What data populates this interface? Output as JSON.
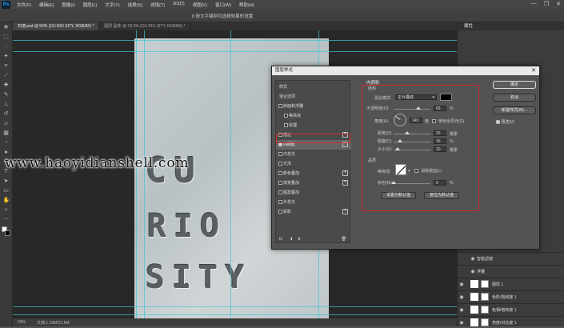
{
  "menubar": {
    "logo": "Ps",
    "items": [
      "文件(F)",
      "编辑(E)",
      "图像(I)",
      "图层(L)",
      "文字(Y)",
      "选择(S)",
      "滤镜(T)",
      "3D(D)",
      "视图(V)",
      "窗口(W)",
      "帮助(H)"
    ],
    "window_buttons": [
      "—",
      "❐",
      "✕"
    ]
  },
  "optionsbar": {
    "title": "8 段文字镂刻可选择效果的设置"
  },
  "tabs": [
    {
      "label": "石墙.psd @ 50% (CU RIO SITY, RGB/8#) *",
      "active": true
    },
    {
      "label": "图层 副本 @ 33.3% (CU RIO SITY, RGB/8#) *",
      "active": false
    }
  ],
  "document": {
    "line1": "CU",
    "line2": "RIO",
    "line3": "SITY"
  },
  "watermark": "www.haoyidianshell.com",
  "statusbar": {
    "zoom": "50%",
    "doc": "文档:1.19M/21.6M"
  },
  "right_panel": {
    "tab": "属性",
    "layers": [
      {
        "name": "智能滤镜",
        "sub": true
      },
      {
        "name": "浮雕",
        "sub": true
      },
      {
        "name": "图层 1"
      },
      {
        "name": "色阶/饱和度 1"
      },
      {
        "name": "色相/饱和度 1"
      },
      {
        "name": "亮度/对比度 1"
      }
    ]
  },
  "dialog": {
    "title": "图层样式",
    "close": "✕",
    "left_items": [
      {
        "label": "样式",
        "check": false,
        "plus": false
      },
      {
        "label": "混合选项",
        "check": false,
        "plus": false
      },
      {
        "label": "斜面和浮雕",
        "check": true,
        "checked": false,
        "plus": false
      },
      {
        "label": "等高线",
        "check": true,
        "checked": false,
        "plus": false,
        "indent": true
      },
      {
        "label": "纹理",
        "check": true,
        "checked": false,
        "plus": false,
        "indent": true
      },
      {
        "label": "描边",
        "check": true,
        "checked": false,
        "plus": true
      },
      {
        "label": "内阴影",
        "check": true,
        "checked": true,
        "plus": true,
        "selected": true
      },
      {
        "label": "内发光",
        "check": true,
        "checked": false,
        "plus": false
      },
      {
        "label": "光泽",
        "check": true,
        "checked": false,
        "plus": false
      },
      {
        "label": "颜色叠加",
        "check": true,
        "checked": false,
        "plus": true
      },
      {
        "label": "渐变叠加",
        "check": true,
        "checked": false,
        "plus": true
      },
      {
        "label": "图案叠加",
        "check": true,
        "checked": false,
        "plus": false
      },
      {
        "label": "外发光",
        "check": true,
        "checked": false,
        "plus": false
      },
      {
        "label": "投影",
        "check": true,
        "checked": false,
        "plus": true
      }
    ],
    "fx_bar": "fx",
    "section_title": "内阴影",
    "structure_title": "结构",
    "blend_mode_label": "混合模式:",
    "blend_mode_value": "正片叠底",
    "opacity_label": "不透明度(O):",
    "opacity_value": "65",
    "angle_label": "角度(A):",
    "angle_value": "145",
    "angle_unit": "度",
    "global_light_label": "使用全局光(G)",
    "distance_label": "距离(D):",
    "distance_value": "25",
    "choke_label": "阻塞(C):",
    "choke_value": "16",
    "size_label": "大小(S):",
    "size_value": "10",
    "px_unit": "像素",
    "pct_unit": "%",
    "quality_title": "品质",
    "contour_label": "等高线:",
    "antialias_label": "消除锯齿(L)",
    "noise_label": "杂色(N):",
    "noise_value": "0",
    "default_btn": "设置为默认值",
    "reset_btn": "复位为默认值",
    "ok": "确定",
    "cancel": "取消",
    "new_style": "新建样式(W)...",
    "preview": "预览(V)"
  }
}
